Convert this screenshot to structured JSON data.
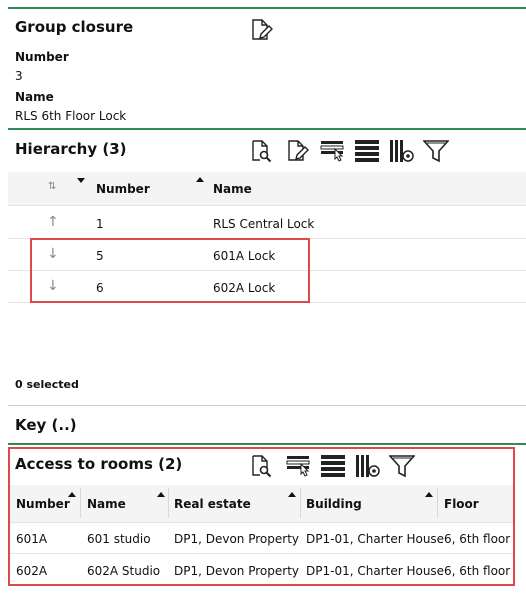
{
  "group": {
    "title": "Group closure",
    "number_label": "Number",
    "number_value": "3",
    "name_label": "Name",
    "name_value": "RLS 6th Floor Lock"
  },
  "hierarchy": {
    "title": "Hierarchy (3)",
    "sort_glyph": "⇅",
    "columns": [
      "Number",
      "Name"
    ],
    "rows": [
      {
        "direction": "↑",
        "number": "1",
        "name": "RLS Central Lock"
      },
      {
        "direction": "↓",
        "number": "5",
        "name": "601A Lock"
      },
      {
        "direction": "↓",
        "number": "6",
        "name": "602A Lock"
      }
    ],
    "selected_text": "0 selected"
  },
  "key": {
    "title": "Key (..)"
  },
  "rooms": {
    "title": "Access to rooms (2)",
    "columns": [
      "Number",
      "Name",
      "Real estate",
      "Building",
      "Floor"
    ],
    "rows": [
      {
        "number": "601A",
        "name": "601 studio",
        "real_estate": "DP1, Devon Property",
        "building": "DP1-01, Charter House",
        "floor": "6, 6th floor"
      },
      {
        "number": "602A",
        "name": "602A Studio",
        "real_estate": "DP1, Devon Property",
        "building": "DP1-01, Charter House",
        "floor": "6, 6th floor"
      }
    ]
  },
  "colors": {
    "section_divider": "#2e8b57",
    "highlight": "#e0474c"
  },
  "icons": {
    "edit": "edit-document-icon",
    "search": "search-document-icon",
    "select": "select-rows-icon",
    "rows": "list-rows-icon",
    "columns": "column-settings-icon",
    "filter": "filter-icon"
  }
}
